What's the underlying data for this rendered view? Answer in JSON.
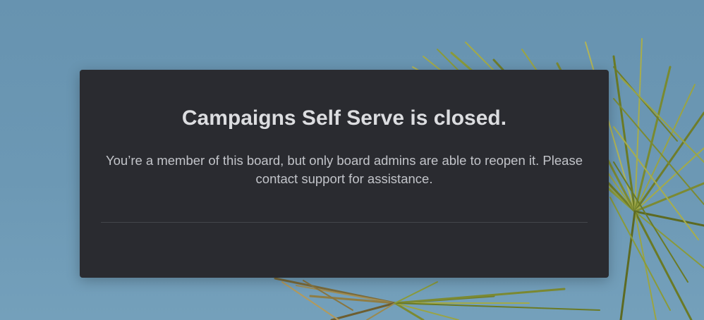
{
  "dialog": {
    "title": "Campaigns Self Serve is closed.",
    "message": "You’re a member of this board, but only board admins are able to reopen it. Please contact support for assistance."
  },
  "colors": {
    "sky": "#6b97b3",
    "dialog_background": "#2a2b30",
    "title_text": "#dcdde0",
    "body_text": "#c2c4c9",
    "divider": "#43454b"
  }
}
